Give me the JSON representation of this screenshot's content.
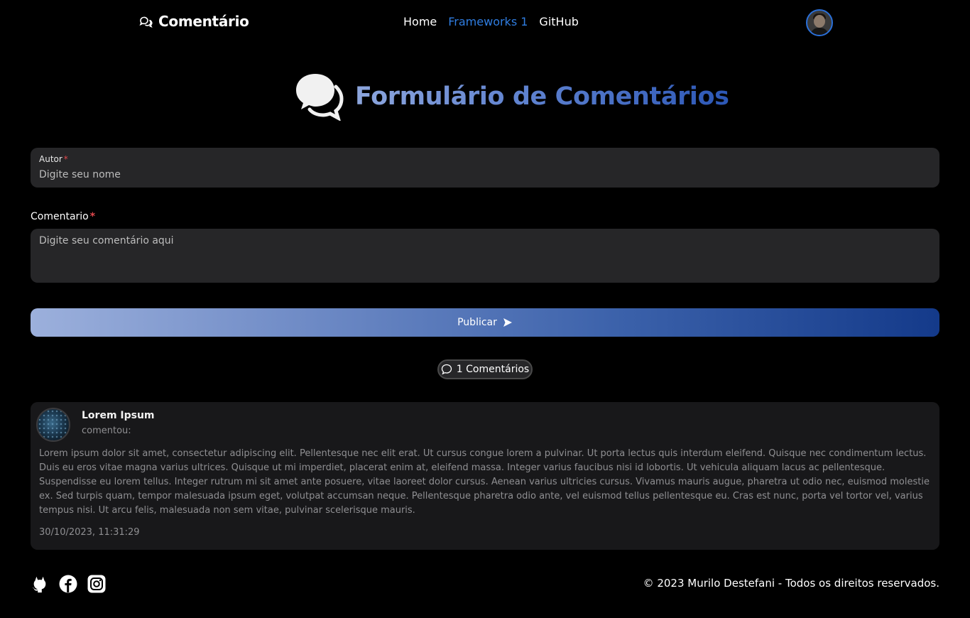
{
  "header": {
    "brand": "Comentário",
    "nav": [
      {
        "label": "Home",
        "active": false
      },
      {
        "label": "Frameworks 1",
        "active": true
      },
      {
        "label": "GitHub",
        "active": false
      }
    ]
  },
  "hero": {
    "title": "Formulário de Comentários"
  },
  "form": {
    "author_label": "Autor",
    "author_placeholder": "Digite seu nome",
    "comment_label": "Comentario",
    "comment_placeholder": "Digite seu comentário aqui",
    "required_mark": "*",
    "publish_label": "Publicar"
  },
  "comments_count": "1 Comentários",
  "comments": [
    {
      "author": "Lorem Ipsum",
      "subtitle": "comentou:",
      "body": "Lorem ipsum dolor sit amet, consectetur adipiscing elit. Pellentesque nec elit erat. Ut cursus congue lorem a pulvinar. Ut porta lectus quis interdum eleifend. Quisque nec condimentum lectus. Duis eu eros vitae magna varius ultrices. Quisque ut mi imperdiet, placerat enim at, eleifend massa. Integer varius faucibus nisi id lobortis. Ut vehicula aliquam lacus ac pellentesque. Suspendisse eu lorem tellus. Integer rutrum mi sit amet ante posuere, vitae laoreet dolor cursus. Aenean varius ultricies cursus. Vivamus mauris augue, pharetra ut odio nec, euismod molestie ex. Sed turpis quam, tempor malesuada ipsum eget, volutpat accumsan neque. Pellentesque pharetra odio ante, vel euismod tellus pellentesque eu. Cras est nunc, porta vel tortor vel, varius tempus nisi. Ut arcu felis, malesuada non sem vitae, pulvinar scelerisque mauris.",
      "date": "30/10/2023, 11:31:29"
    }
  ],
  "footer": {
    "social_icons": [
      "github-icon",
      "facebook-icon",
      "instagram-icon"
    ],
    "copyright": "© 2023 Murilo Destefani - Todos os direitos reservados."
  },
  "colors": {
    "accent": "#2f7de1",
    "required": "#e0474c",
    "card_bg": "#18181a",
    "input_bg": "#262628"
  }
}
